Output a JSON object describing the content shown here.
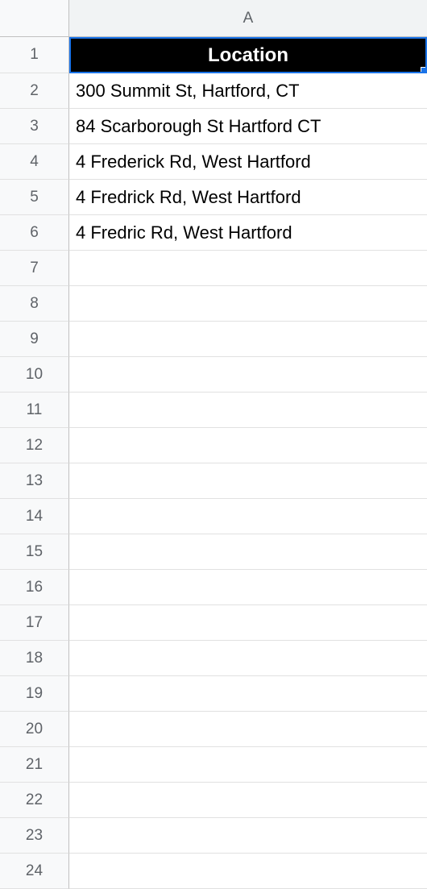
{
  "columns": [
    "A"
  ],
  "header_row": {
    "label": "Location"
  },
  "rows": [
    {
      "num": "1",
      "value": "Location",
      "is_header": true
    },
    {
      "num": "2",
      "value": "300 Summit St, Hartford, CT"
    },
    {
      "num": "3",
      "value": "84 Scarborough St Hartford CT"
    },
    {
      "num": "4",
      "value": "4 Frederick Rd, West Hartford"
    },
    {
      "num": "5",
      "value": "4 Fredrick Rd, West Hartford"
    },
    {
      "num": "6",
      "value": "4 Fredric Rd, West Hartford"
    },
    {
      "num": "7",
      "value": ""
    },
    {
      "num": "8",
      "value": ""
    },
    {
      "num": "9",
      "value": ""
    },
    {
      "num": "10",
      "value": ""
    },
    {
      "num": "11",
      "value": ""
    },
    {
      "num": "12",
      "value": ""
    },
    {
      "num": "13",
      "value": ""
    },
    {
      "num": "14",
      "value": ""
    },
    {
      "num": "15",
      "value": ""
    },
    {
      "num": "16",
      "value": ""
    },
    {
      "num": "17",
      "value": ""
    },
    {
      "num": "18",
      "value": ""
    },
    {
      "num": "19",
      "value": ""
    },
    {
      "num": "20",
      "value": ""
    },
    {
      "num": "21",
      "value": ""
    },
    {
      "num": "22",
      "value": ""
    },
    {
      "num": "23",
      "value": ""
    },
    {
      "num": "24",
      "value": ""
    }
  ]
}
